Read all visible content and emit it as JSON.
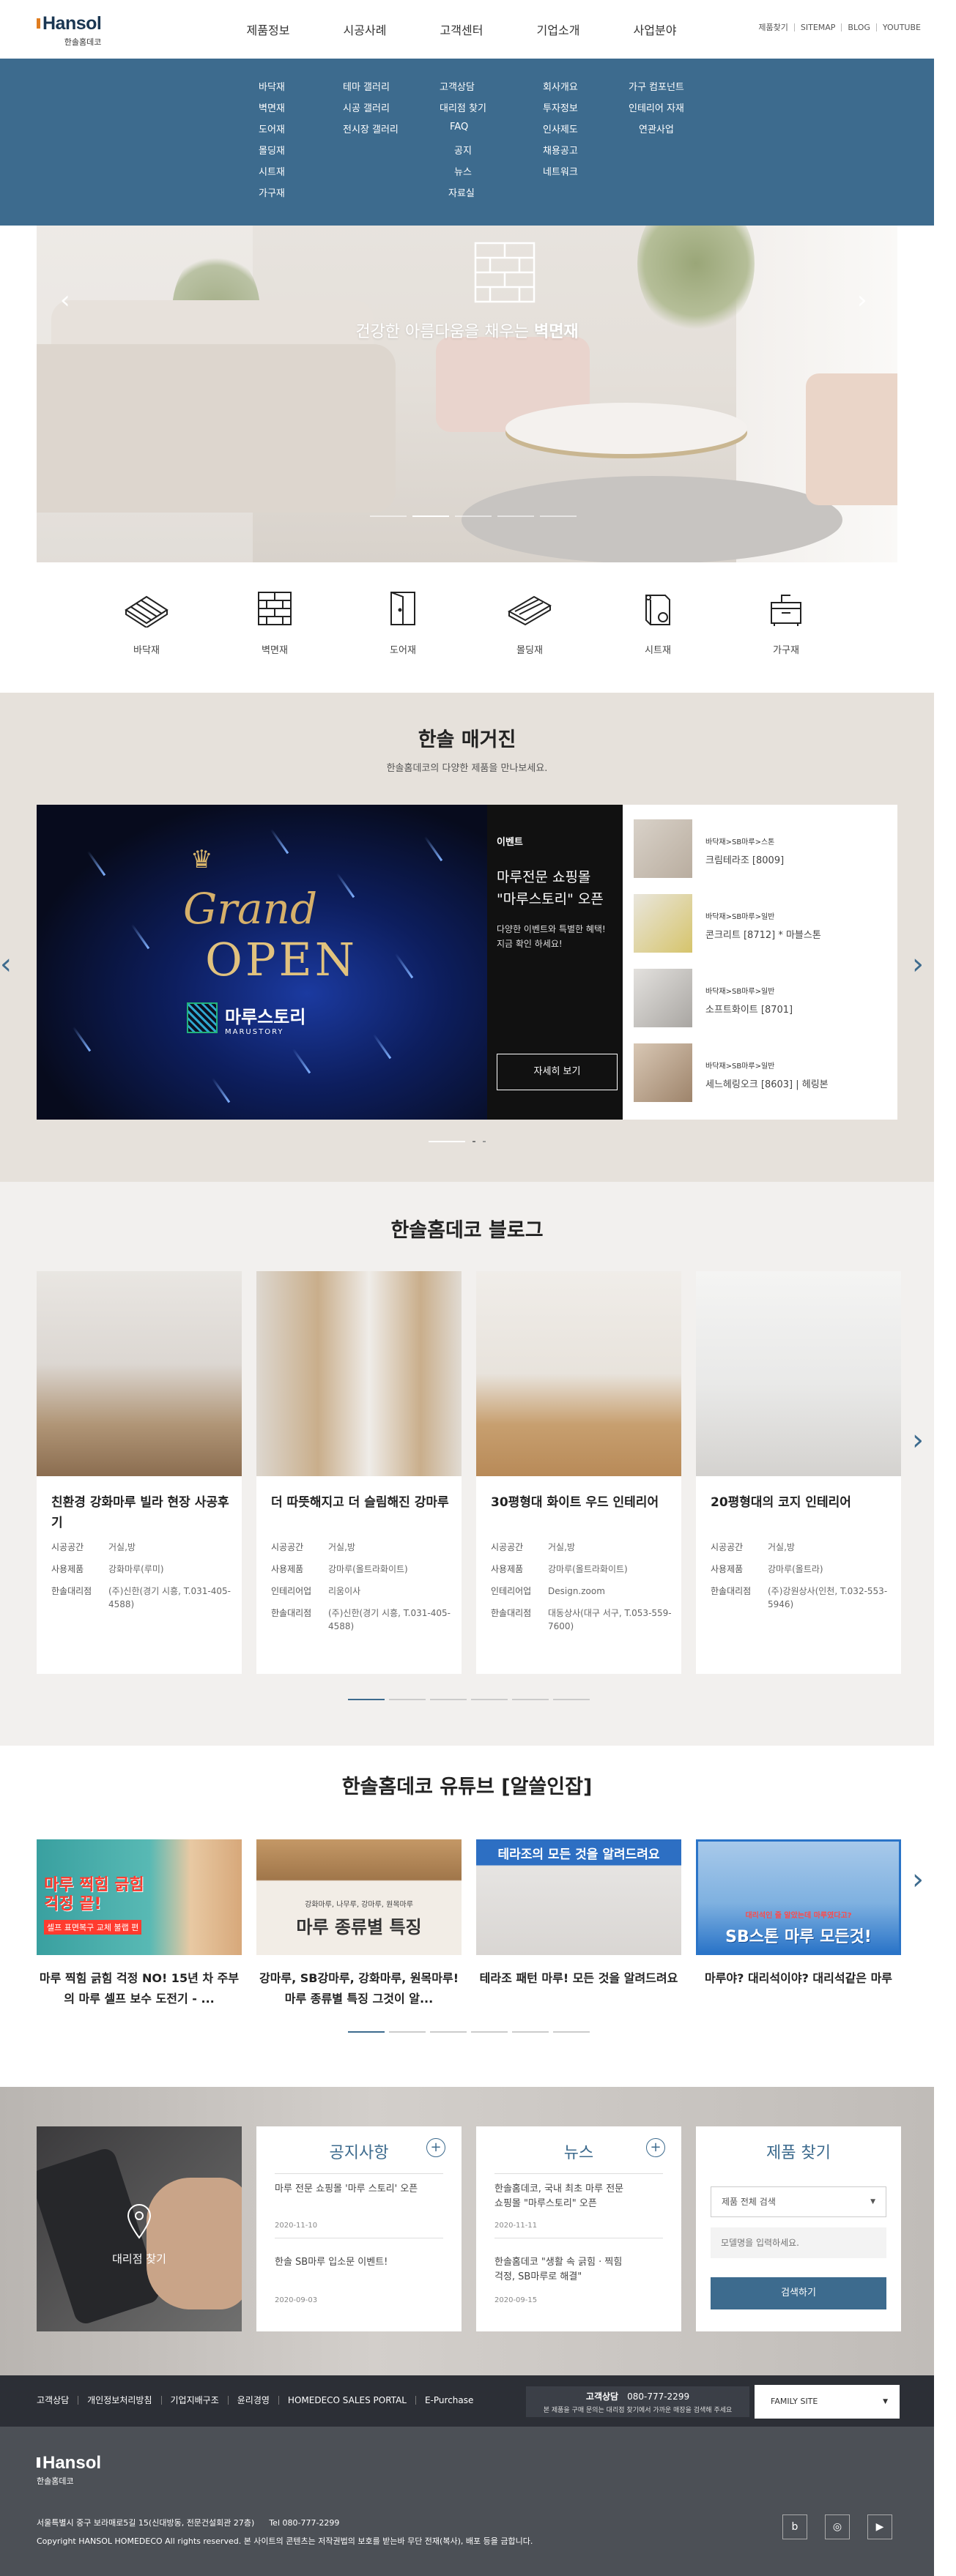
{
  "header": {
    "logo_text": "Hansol",
    "logo_sub": "한솔홈데코",
    "gnb": [
      "제품정보",
      "시공사례",
      "고객센터",
      "기업소개",
      "사업분야"
    ],
    "util": [
      "제품찾기",
      "SITEMAP",
      "BLOG",
      "YOUTUBE"
    ]
  },
  "mega_menu": {
    "col1": [
      "바닥재",
      "벽면재",
      "도어재",
      "몰딩재",
      "시트재",
      "가구재"
    ],
    "col2": [
      "테마 갤러리",
      "시공 갤러리",
      "전시장 갤러리"
    ],
    "col3": [
      "고객상담",
      "대리점 찾기",
      "FAQ",
      "공지",
      "뉴스",
      "자료실"
    ],
    "col4": [
      "회사개요",
      "투자정보",
      "인사제도",
      "채용공고",
      "네트워크"
    ],
    "col5": [
      "가구 컴포넌트",
      "인테리어 자재",
      "연관사업"
    ]
  },
  "hero": {
    "text_pre": "건강한 아름다움을 채우는",
    "text_bold": "벽면재",
    "prev_arrow": "‹",
    "next_arrow": "›"
  },
  "categories": [
    "바닥재",
    "벽면재",
    "도어재",
    "몰딩재",
    "시트재",
    "가구재"
  ],
  "magazine": {
    "title": "한솔 매거진",
    "subtitle": "한솔홈데코의 다양한 제품을 만나보세요.",
    "banner": {
      "grand": "Grand",
      "open": "OPEN",
      "maru_kr": "마루스토리",
      "maru_en": "MARUSTORY"
    },
    "event": {
      "tag": "이벤트",
      "title_line1": "마루전문 쇼핑몰",
      "title_line2": "\"마루스토리\" 오픈",
      "desc_line1": "다양한 이벤트와 특별한 혜택!",
      "desc_line2": "지금 확인 하세요!",
      "button": "자세히 보기"
    },
    "items": [
      {
        "path": "바닥재>SB마루>스톤",
        "name": "크림테라조 [8009]"
      },
      {
        "path": "바닥재>SB마루>일반",
        "name": "콘크리트 [8712] * 마블스톤"
      },
      {
        "path": "바닥재>SB마루>일반",
        "name": "소프트화이트 [8701]"
      },
      {
        "path": "바닥재>SB마루>일반",
        "name": "세느헤링오크 [8603] | 헤링본"
      }
    ]
  },
  "blog": {
    "title": "한솔홈데코 블로그",
    "cards": [
      {
        "title": "친환경 강화마루 빌라 현장 사공후기",
        "rows": [
          [
            "시공공간",
            "거실,방"
          ],
          [
            "사용제품",
            "강화마루(루미)"
          ],
          [
            "한솔대리점",
            "(주)신한(경기 시흥, T.031-405-4588)"
          ]
        ]
      },
      {
        "title": "더 따뜻해지고 더 슬림해진 강마루",
        "rows": [
          [
            "시공공간",
            "거실,방"
          ],
          [
            "사용제품",
            "강마루(올트라화이트)"
          ],
          [
            "인테리어업",
            "리움이사"
          ],
          [
            "한솔대리점",
            "(주)신한(경기 시흥, T.031-405-4588)"
          ]
        ]
      },
      {
        "title": "30평형대 화이트 우드 인테리어",
        "rows": [
          [
            "시공공간",
            "거실,방"
          ],
          [
            "사용제품",
            "강마루(올트라화이트)"
          ],
          [
            "인테리어업",
            "Design.zoom"
          ],
          [
            "한솔대리점",
            "대동상사(대구 서구, T.053-559-7600)"
          ]
        ]
      },
      {
        "title": "20평형대의 코지 인테리어",
        "rows": [
          [
            "시공공간",
            "거실,방"
          ],
          [
            "사용제품",
            "강마루(올트라)"
          ],
          [
            "한솔대리점",
            "(주)강원상사(인천, T.032-553-5946)"
          ]
        ]
      }
    ]
  },
  "youtube": {
    "title": "한솔홈데코 유튜브 [알쓸인잡]",
    "videos": [
      {
        "caption": "마루 찍힘 긁힘 걱정 NO! 15년 차 주부의 마루 셀프 보수 도전기 - ...",
        "thumb_big": "마루 찍힘 긁힘 걱정 끝!",
        "thumb_small": "셀프 표면복구 교체 불랩 편"
      },
      {
        "caption": "강마루, SB강마루, 강화마루, 원목마루! 마루 종류별 특징 그것이 알...",
        "thumb_small": "강화마루, 나무루, 강마루, 원목마루",
        "thumb_big": "마루 종류별 특징"
      },
      {
        "caption": "테라조 패턴 마루! 모든 것을 알려드려요",
        "thumb_big": "테라조의 모든 것을 알려드려요"
      },
      {
        "caption": "마루야? 대리석이야? 대리석같은 마루",
        "thumb_big": "SB스톤 마루 모든것!",
        "thumb_small": "대리석인 줄 알았는데 마루였다고?"
      }
    ]
  },
  "bottom": {
    "store_label": "대리점 찾기",
    "notice": {
      "title": "공지사항",
      "plus": "+",
      "items": [
        {
          "title": "마루 전문 쇼핑몰 '마루 스토리' 오픈",
          "date": "2020-11-10"
        },
        {
          "title": "한솔 SB마루 입소문 이벤트!",
          "date": "2020-09-03"
        }
      ]
    },
    "news": {
      "title": "뉴스",
      "plus": "+",
      "items": [
        {
          "title_line1": "한솔홈데코, 국내 최초 마루 전문",
          "title_line2": "쇼핑몰 \"마루스토리\" 오픈",
          "date": "2020-11-11"
        },
        {
          "title_line1": "한솔홈데코 \"생활 속 긁힘 · 찍힘",
          "title_line2": "걱정, SB마루로 해결\"",
          "date": "2020-09-15"
        }
      ]
    },
    "find": {
      "title": "제품 찾기",
      "select": "제품 전체 검색",
      "placeholder": "모델명을 입력하세요.",
      "button": "검색하기"
    }
  },
  "footer": {
    "links": [
      "고객상담",
      "개인정보처리방침",
      "기업지배구조",
      "윤리경영",
      "HOMEDECO SALES PORTAL",
      "E-Purchase"
    ],
    "cs_label": "고객상담",
    "cs_phone": "080-777-2299",
    "cs_note": "본 제품을 구매 문의는 대리점 찾기에서 가까운 매장을 검색해 주세요",
    "family_site": "FAMILY SITE",
    "logo_text": "Hansol",
    "logo_sub": "한솔홈데코",
    "address": "서울특별시 중구 보라매로5길 15(신대방동, 전문건설회관 27층)",
    "tel": "Tel 080-777-2299",
    "copyright": "Copyright HANSOL HOMEDECO All rights reserved. 본 사이트의 콘텐츠는 저작권법의 보호를 받는바 무단 전재(복사), 배포 등을 금합니다."
  },
  "colors": {
    "accent": "#3d6b8e",
    "brand_dot": "#e07d20",
    "footer_bar": "#2c2f36",
    "footer": "#4c5056"
  }
}
